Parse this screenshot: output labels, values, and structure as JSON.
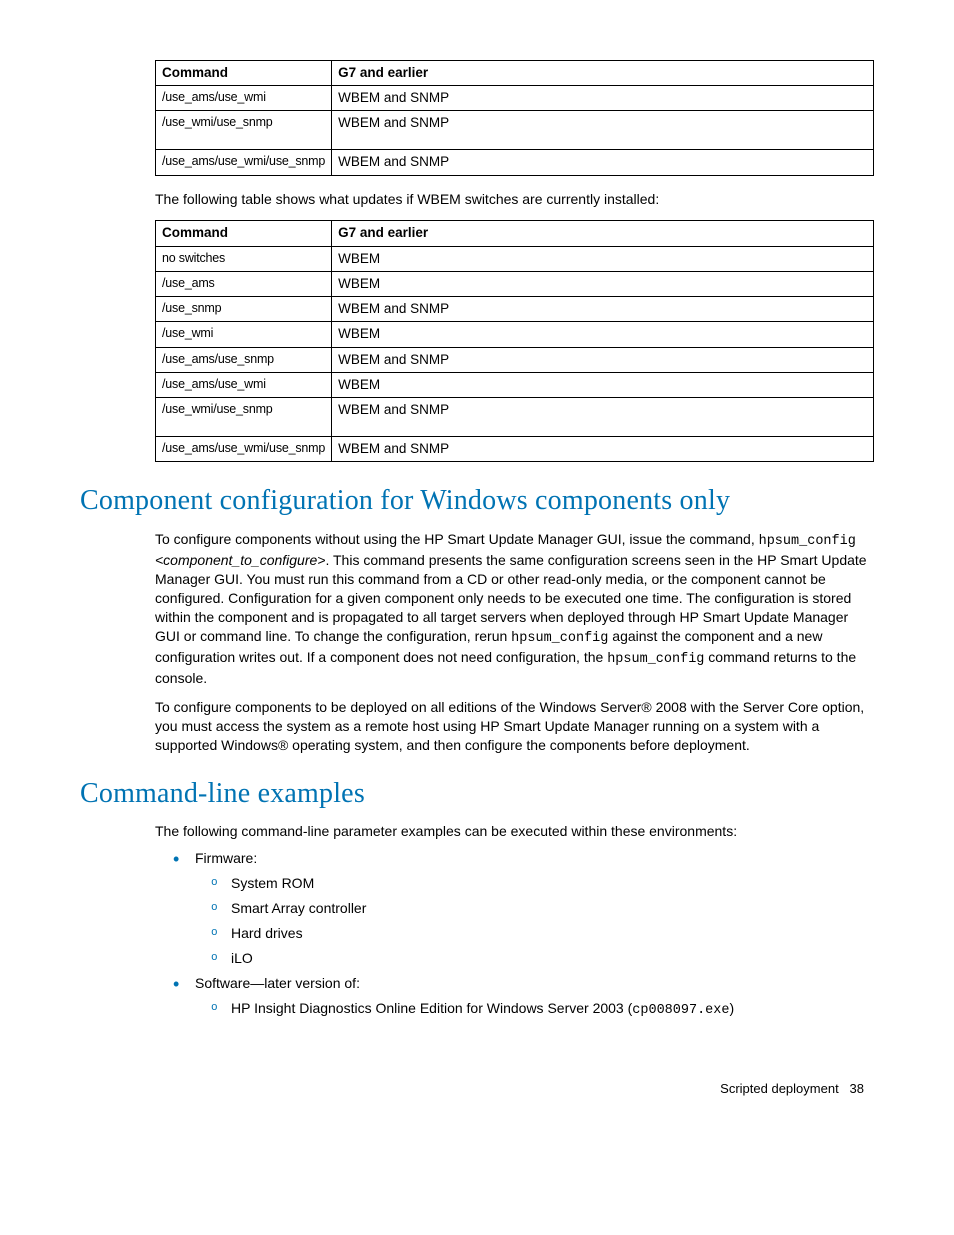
{
  "table1": {
    "headers": [
      "Command",
      "G7 and earlier"
    ],
    "rows": [
      [
        "/use_ams/use_wmi",
        "WBEM and SNMP"
      ],
      [
        "/use_wmi/use_snmp",
        "WBEM and SNMP"
      ],
      [
        "/use_ams/use_wmi/use_snmp",
        "WBEM and SNMP"
      ]
    ]
  },
  "intro2": "The following table shows what updates if WBEM switches are currently installed:",
  "table2": {
    "headers": [
      "Command",
      "G7 and earlier"
    ],
    "rows": [
      [
        "no switches",
        "WBEM"
      ],
      [
        "/use_ams",
        "WBEM"
      ],
      [
        "/use_snmp",
        "WBEM and SNMP"
      ],
      [
        "/use_wmi",
        "WBEM"
      ],
      [
        "/use_ams/use_snmp",
        "WBEM and SNMP"
      ],
      [
        "/use_ams/use_wmi",
        "WBEM"
      ],
      [
        "/use_wmi/use_snmp",
        "WBEM and SNMP"
      ],
      [
        "/use_ams/use_wmi/use_snmp",
        "WBEM and SNMP"
      ]
    ]
  },
  "sec1": {
    "heading": "Component configuration for Windows components only",
    "p1a": "To configure components without using the HP Smart Update Manager GUI, issue the command, ",
    "p1_cmd": "hpsum_config",
    "p1_arg": " <component_to_configure>",
    "p1b": ". This command presents the same configuration screens seen in the HP Smart Update Manager GUI. You must run this command from a CD or other read-only media, or the component cannot be configured. Configuration for a given component only needs to be executed one time. The configuration is stored within the component and is propagated to all target servers when deployed through HP Smart Update Manager GUI or command line. To change the configuration, rerun ",
    "p1_cmd2": "hpsum_config",
    "p1c": " against the component and a new configuration writes out. If a component does not need configuration, the ",
    "p1_cmd3": "hpsum_config",
    "p1d": " command returns to the console.",
    "p2": "To configure components to be deployed on all editions of the Windows Server® 2008 with the Server Core option, you must access the system as a remote host using HP Smart Update Manager running on a system with a supported Windows® operating system, and then configure the components before deployment."
  },
  "sec2": {
    "heading": "Command-line examples",
    "intro": "The following command-line parameter examples can be executed within these environments:",
    "b1": "Firmware:",
    "b1_1": "System ROM",
    "b1_2": "Smart Array controller",
    "b1_3": "Hard drives",
    "b1_4": "iLO",
    "b2": "Software—later version of:",
    "b2_1a": "HP Insight Diagnostics Online Edition for Windows Server 2003 (",
    "b2_1b": "cp008097.exe",
    "b2_1c": ")"
  },
  "footer": {
    "section": "Scripted deployment",
    "page": "38"
  }
}
